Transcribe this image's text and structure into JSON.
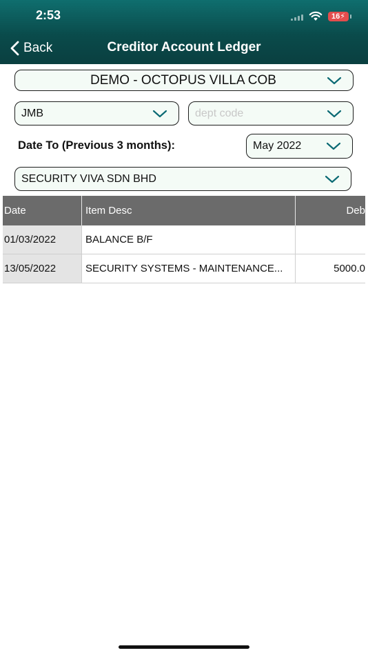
{
  "status_bar": {
    "time": "2:53",
    "battery": "16"
  },
  "nav": {
    "back_label": "Back",
    "title": "Creditor Account Ledger"
  },
  "filters": {
    "property": "DEMO - OCTOPUS VILLA COB",
    "type": "JMB",
    "dept_placeholder": "dept code",
    "date_label": "Date To (Previous 3 months):",
    "date_value": "May 2022",
    "creditor": "SECURITY VIVA SDN BHD"
  },
  "table": {
    "headers": {
      "date": "Date",
      "desc": "Item Desc",
      "debit": "Deb"
    },
    "rows": [
      {
        "date": "01/03/2022",
        "desc": "BALANCE B/F",
        "debit": ""
      },
      {
        "date": "13/05/2022",
        "desc": "SECURITY SYSTEMS - MAINTENANCE...",
        "debit": "5000.0"
      }
    ]
  },
  "colors": {
    "header_bg": "#0a4b4b",
    "accent": "#0b6a74",
    "table_header": "#6b6b6b"
  }
}
